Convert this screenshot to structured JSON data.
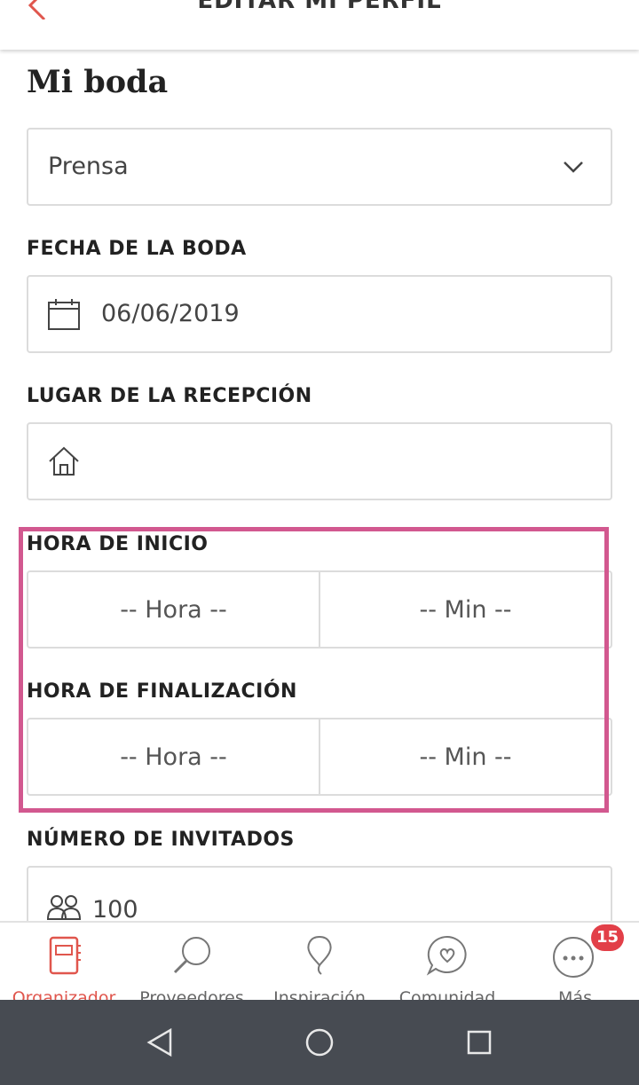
{
  "header": {
    "title": "EDITAR MI PERFIL",
    "back_icon": "chevron-left-icon"
  },
  "main": {
    "section_title": "Mi boda",
    "role_select": {
      "value": "Prensa",
      "icon": "chevron-down-icon"
    },
    "wedding_date": {
      "label": "FECHA DE LA BODA",
      "value": "06/06/2019",
      "icon": "calendar-icon"
    },
    "reception_place": {
      "label": "LUGAR DE LA RECEPCIÓN",
      "value": "",
      "icon": "house-icon"
    },
    "start_time": {
      "label": "HORA DE INICIO",
      "hour_placeholder": "-- Hora --",
      "min_placeholder": "-- Min --"
    },
    "end_time": {
      "label": "HORA DE FINALIZACIÓN",
      "hour_placeholder": "-- Hora --",
      "min_placeholder": "-- Min --"
    },
    "guests": {
      "label": "NÚMERO DE INVITADOS",
      "value": "100",
      "icon": "people-icon"
    },
    "highlight_color": "#d2588f"
  },
  "tabbar": {
    "accent_color": "#e0564d",
    "items": [
      {
        "label": "Organizador",
        "icon": "planner-book-icon",
        "active": true
      },
      {
        "label": "Proveedores",
        "icon": "magnifier-icon"
      },
      {
        "label": "Inspiración",
        "icon": "balloon-icon"
      },
      {
        "label": "Comunidad",
        "icon": "chat-heart-icon"
      },
      {
        "label": "Más",
        "icon": "more-dots-icon",
        "badge": "15"
      }
    ]
  },
  "system_nav": {
    "buttons": [
      "back-triangle-icon",
      "home-circle-icon",
      "recents-square-icon"
    ]
  }
}
